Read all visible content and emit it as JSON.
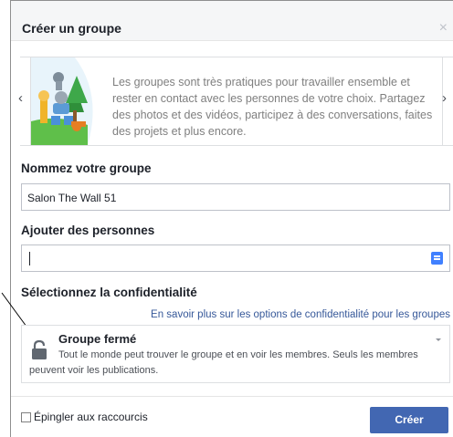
{
  "dialog": {
    "title": "Créer un groupe",
    "close_icon": "×"
  },
  "carousel": {
    "prev_icon": "‹",
    "next_icon": "›",
    "description": "Les groupes sont très pratiques pour travailler ensemble et rester en contact avec les personnes de votre choix. Partagez des photos et des vidéos, participez à des conversations, faites des projets et plus encore."
  },
  "name_section": {
    "label": "Nommez votre groupe",
    "value": "Salon The Wall 51"
  },
  "people_section": {
    "label": "Ajouter des personnes",
    "value": ""
  },
  "privacy_section": {
    "label": "Sélectionnez la confidentialité",
    "link": "En savoir plus sur les options de confidentialité pour les groupes",
    "selected_title": "Groupe fermé",
    "selected_desc": "Tout le monde peut trouver le groupe et en voir les membres. Seuls les membres peuvent voir les publications."
  },
  "footer": {
    "pin_label": "Épingler aux raccourcis",
    "create_label": "Créer"
  },
  "colors": {
    "primary_button": "#4267b2",
    "link": "#365899",
    "emoji_button": "#4080ff"
  }
}
